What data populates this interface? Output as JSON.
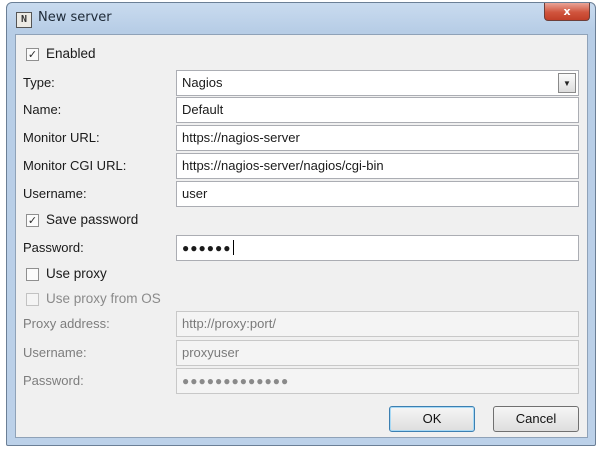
{
  "window": {
    "title": "New server",
    "icon_glyph": "N",
    "icon": "nagios-app-icon",
    "close_glyph": "x"
  },
  "form": {
    "enabled": {
      "label": "Enabled",
      "checked": true
    },
    "type": {
      "label": "Type:",
      "value": "Nagios"
    },
    "name": {
      "label": "Name:",
      "value": "Default"
    },
    "monitor_url": {
      "label": "Monitor URL:",
      "value": "https://nagios-server"
    },
    "monitor_cgi_url": {
      "label": "Monitor CGI URL:",
      "value": "https://nagios-server/nagios/cgi-bin"
    },
    "username": {
      "label": "Username:",
      "value": "user"
    },
    "save_password": {
      "label": "Save password",
      "checked": true
    },
    "password": {
      "label": "Password:",
      "value": "●●●●●●"
    },
    "use_proxy": {
      "label": "Use proxy",
      "checked": false
    },
    "use_proxy_from_os": {
      "label": "Use proxy from OS",
      "checked": false,
      "enabled": false
    },
    "proxy_address": {
      "label": "Proxy address:",
      "value": "http://proxy:port/"
    },
    "proxy_username": {
      "label": "Username:",
      "value": "proxyuser"
    },
    "proxy_password": {
      "label": "Password:",
      "value": "●●●●●●●●●●●●●"
    }
  },
  "buttons": {
    "ok": "OK",
    "cancel": "Cancel"
  },
  "glyphs": {
    "checkmark": "✓",
    "dropdown_arrow": "▼"
  },
  "colors": {
    "window_frame": "#b7cde6",
    "dialog_background": "#f0f0f0",
    "close_button": "#c9462f",
    "default_button_border": "#3c7fb1"
  }
}
